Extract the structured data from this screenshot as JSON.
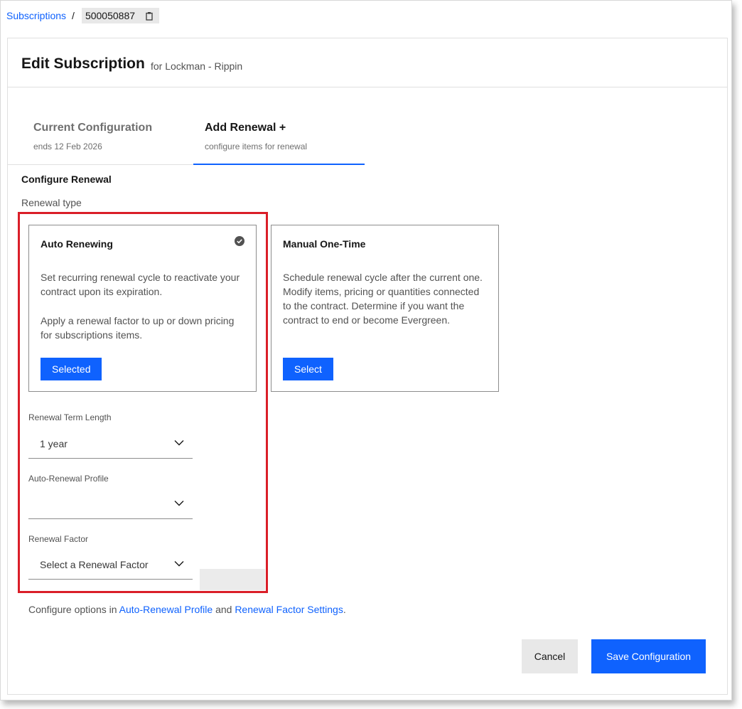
{
  "breadcrumb": {
    "root_label": "Subscriptions",
    "separator": "/",
    "id": "500050887"
  },
  "header": {
    "title": "Edit Subscription",
    "subtitle": "for Lockman - Rippin"
  },
  "tabs": [
    {
      "label": "Current Configuration",
      "sublabel": "ends 12 Feb 2026",
      "active": false
    },
    {
      "label": "Add Renewal +",
      "sublabel": "configure items for renewal",
      "active": true
    }
  ],
  "configure": {
    "section_title": "Configure Renewal",
    "renewal_type_label": "Renewal type",
    "cards": [
      {
        "title": "Auto Renewing",
        "paragraphs": [
          "Set recurring renewal cycle to reactivate your contract upon its expiration.",
          "Apply a renewal factor to up or down pricing for subscriptions items."
        ],
        "button_label": "Selected",
        "selected": true
      },
      {
        "title": "Manual One-Time",
        "paragraphs": [
          "Schedule renewal cycle after the current one. Modify items, pricing or quantities connected to the contract. Determine if you want the contract to end or become Evergreen."
        ],
        "button_label": "Select",
        "selected": false
      }
    ],
    "fields": {
      "term_length": {
        "label": "Renewal Term Length",
        "value": "1 year"
      },
      "profile": {
        "label": "Auto-Renewal Profile",
        "value": ""
      },
      "factor": {
        "label": "Renewal Factor",
        "value": "Select a Renewal Factor"
      }
    },
    "note": {
      "prefix": "Configure options in",
      "link1": "Auto-Renewal Profile",
      "middle": "and",
      "link2": "Renewal Factor Settings",
      "suffix": "."
    }
  },
  "footer": {
    "cancel_label": "Cancel",
    "save_label": "Save Configuration"
  },
  "colors": {
    "accent": "#0f62fe",
    "highlight": "#da1e28",
    "text": "#161616",
    "muted": "#525252"
  }
}
